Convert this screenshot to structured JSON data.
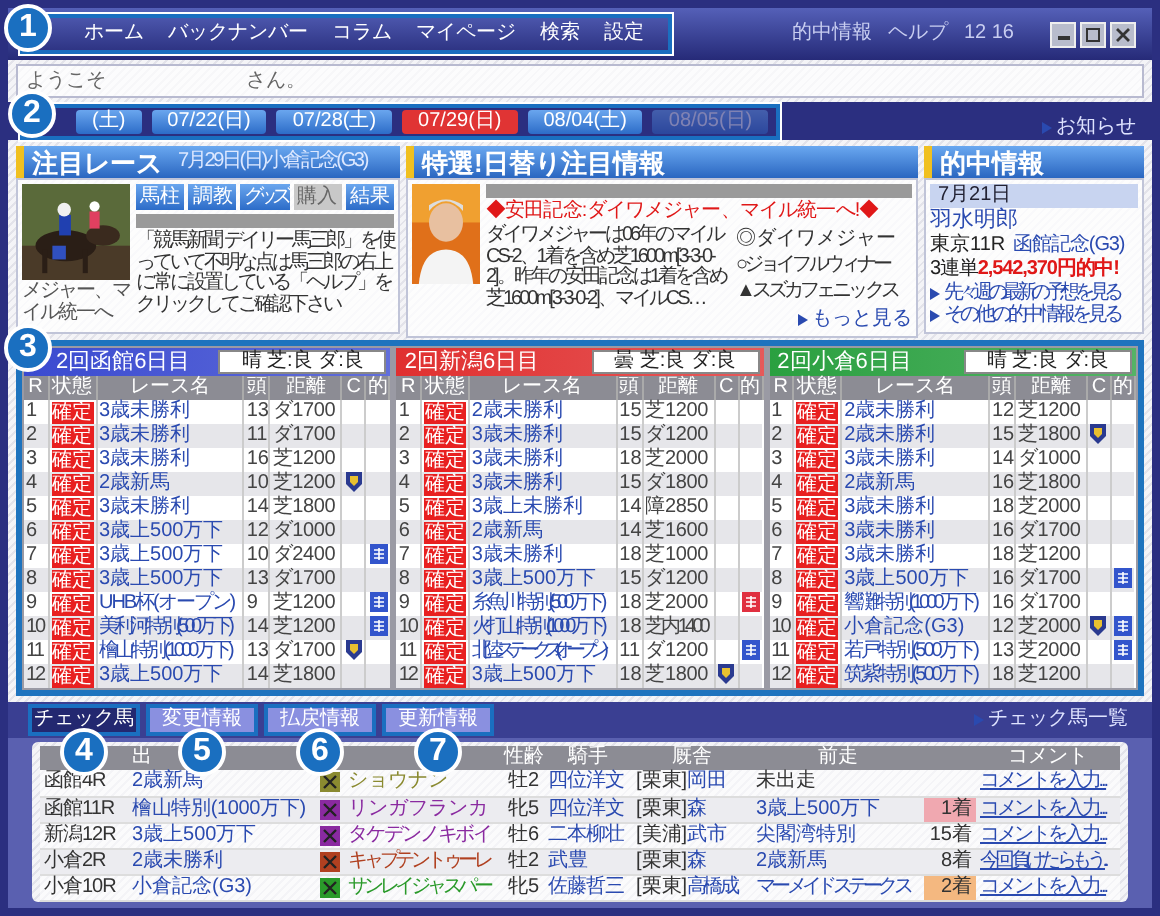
{
  "nav": {
    "items": [
      "ホーム",
      "バックナンバー",
      "コラム",
      "マイページ",
      "検索",
      "設定"
    ],
    "right_links": [
      "的中情報",
      "ヘルプ"
    ],
    "clock": "12 16"
  },
  "welcome": {
    "prefix": "ようこそ",
    "suffix": "さん。"
  },
  "date_tabs": [
    {
      "label": "(土)",
      "selected": false,
      "disabled": false
    },
    {
      "label": "07/22(日)",
      "selected": false,
      "disabled": false
    },
    {
      "label": "07/28(土)",
      "selected": false,
      "disabled": false
    },
    {
      "label": "07/29(日)",
      "selected": true,
      "disabled": false
    },
    {
      "label": "08/04(土)",
      "selected": false,
      "disabled": false
    },
    {
      "label": "08/05(日)",
      "selected": false,
      "disabled": true
    }
  ],
  "notice_link": "お知らせ",
  "featured_race": {
    "title": "注目レース",
    "subtitle": "7月29日(日)小倉記念(G3)",
    "photo_caption": "メジャー、マイル統一へ",
    "buttons": [
      {
        "label": "馬柱",
        "disabled": false
      },
      {
        "label": "調教",
        "disabled": false
      },
      {
        "label": "グッズ",
        "disabled": false
      },
      {
        "label": "購入",
        "disabled": true
      },
      {
        "label": "結果",
        "disabled": false
      }
    ],
    "notice": "「競馬新聞 デイリー馬三郎」を使っていて不明な点は馬三郎の右上に常に設置している「ヘルプ」をクリックしてご確認下さい"
  },
  "daily_pick": {
    "title": "特選!日替り注目情報",
    "headline": "◆安田記念:ダイワメジャー、マイル統一へ!◆",
    "body": "ダイワメジャーは06年のマイルCS-2、1着を含め芝1600m[3-3-0-2]。昨年の安田記念は1着を含め芝1600m[3-3-0-2]、マイルCS…",
    "picks": [
      "◎ダイワメジャー",
      "○ジョイフルウィナー",
      "▲スズカフェニックス"
    ],
    "more_link": "もっと見る"
  },
  "hit_info": {
    "title": "的中情報",
    "date": "7月21日",
    "name": "羽水明郎",
    "race_prefix": "東京11R",
    "race_link": "函館記念(G3)",
    "payout": "3連単**2,542,370円的中!**",
    "links": [
      "先々週の最新の予想を見る",
      "その他の的中情報を見る"
    ]
  },
  "venues": [
    {
      "title": "2回函館6日目",
      "weather": "晴 芝:良 ダ:良",
      "color": "#3a4ad0",
      "columns": [
        "R",
        "状態",
        "レース名",
        "頭",
        "距離",
        "C",
        "的"
      ],
      "rows": [
        {
          "r": "1",
          "status": "確定",
          "name": "3歳未勝利",
          "runners": "13",
          "distance": "ダ1700",
          "checked": false
        },
        {
          "r": "2",
          "status": "確定",
          "name": "3歳未勝利",
          "runners": "11",
          "distance": "ダ1700",
          "checked": false
        },
        {
          "r": "3",
          "status": "確定",
          "name": "3歳未勝利",
          "runners": "16",
          "distance": "芝1200",
          "checked": false
        },
        {
          "r": "4",
          "status": "確定",
          "name": "2歳新馬",
          "runners": "10",
          "distance": "芝1200",
          "checked": true
        },
        {
          "r": "5",
          "status": "確定",
          "name": "3歳未勝利",
          "runners": "14",
          "distance": "芝1800",
          "checked": false
        },
        {
          "r": "6",
          "status": "確定",
          "name": "3歳上500万下",
          "runners": "12",
          "distance": "ダ1000",
          "checked": false
        },
        {
          "r": "7",
          "status": "確定",
          "name": "3歳上500万下",
          "runners": "10",
          "distance": "ダ2400",
          "checked": false,
          "bet": {
            "color": "#3355cc"
          }
        },
        {
          "r": "8",
          "status": "確定",
          "name": "3歳上500万下",
          "runners": "13",
          "distance": "ダ1700",
          "checked": false
        },
        {
          "r": "9",
          "status": "確定",
          "name": "UHB杯(オープン)",
          "runners": "9",
          "distance": "芝1200",
          "checked": false,
          "bet": {
            "color": "#3355cc"
          }
        },
        {
          "r": "10",
          "status": "確定",
          "name": "美利河特別(500万下)",
          "runners": "14",
          "distance": "芝1200",
          "checked": false,
          "bet": {
            "color": "#3355cc"
          }
        },
        {
          "r": "11",
          "status": "確定",
          "name": "檜山特別(1000万下)",
          "runners": "13",
          "distance": "ダ1700",
          "checked": true
        },
        {
          "r": "12",
          "status": "確定",
          "name": "3歳上500万下",
          "runners": "14",
          "distance": "芝1800",
          "checked": false
        }
      ]
    },
    {
      "title": "2回新潟6日目",
      "weather": "曇 芝:良 ダ:良",
      "color": "#e03030",
      "columns": [
        "R",
        "状態",
        "レース名",
        "頭",
        "距離",
        "C",
        "的"
      ],
      "rows": [
        {
          "r": "1",
          "status": "確定",
          "name": "2歳未勝利",
          "runners": "15",
          "distance": "芝1200",
          "checked": false
        },
        {
          "r": "2",
          "status": "確定",
          "name": "3歳未勝利",
          "runners": "15",
          "distance": "ダ1200",
          "checked": false
        },
        {
          "r": "3",
          "status": "確定",
          "name": "3歳未勝利",
          "runners": "18",
          "distance": "芝2000",
          "checked": false
        },
        {
          "r": "4",
          "status": "確定",
          "name": "3歳未勝利",
          "runners": "15",
          "distance": "ダ1800",
          "checked": false
        },
        {
          "r": "5",
          "status": "確定",
          "name": "3歳上未勝利",
          "runners": "14",
          "distance": "障2850",
          "checked": false
        },
        {
          "r": "6",
          "status": "確定",
          "name": "2歳新馬",
          "runners": "14",
          "distance": "芝1600",
          "checked": false
        },
        {
          "r": "7",
          "status": "確定",
          "name": "3歳未勝利",
          "runners": "18",
          "distance": "芝1000",
          "checked": false
        },
        {
          "r": "8",
          "status": "確定",
          "name": "3歳上500万下",
          "runners": "15",
          "distance": "ダ1200",
          "checked": false
        },
        {
          "r": "9",
          "status": "確定",
          "name": "糸魚川特別(500万下)",
          "runners": "18",
          "distance": "芝2000",
          "checked": false,
          "bet": {
            "color": "#e03040"
          }
        },
        {
          "r": "10",
          "status": "確定",
          "name": "火打山特別(1000万下)",
          "runners": "18",
          "distance": "芝内1400",
          "checked": false
        },
        {
          "r": "11",
          "status": "確定",
          "name": "北陸ステークス(オープン)",
          "runners": "11",
          "distance": "ダ1200",
          "checked": false,
          "bet": {
            "color": "#3355cc"
          }
        },
        {
          "r": "12",
          "status": "確定",
          "name": "3歳上500万下",
          "runners": "18",
          "distance": "芝1800",
          "checked": true
        }
      ]
    },
    {
      "title": "2回小倉6日目",
      "weather": "晴 芝:良 ダ:良",
      "color": "#2aa040",
      "columns": [
        "R",
        "状態",
        "レース名",
        "頭",
        "距離",
        "C",
        "的"
      ],
      "rows": [
        {
          "r": "1",
          "status": "確定",
          "name": "2歳未勝利",
          "runners": "12",
          "distance": "芝1200",
          "checked": false
        },
        {
          "r": "2",
          "status": "確定",
          "name": "2歳未勝利",
          "runners": "15",
          "distance": "芝1800",
          "checked": true
        },
        {
          "r": "3",
          "status": "確定",
          "name": "3歳未勝利",
          "runners": "14",
          "distance": "ダ1000",
          "checked": false
        },
        {
          "r": "4",
          "status": "確定",
          "name": "2歳新馬",
          "runners": "16",
          "distance": "芝1800",
          "checked": false
        },
        {
          "r": "5",
          "status": "確定",
          "name": "3歳未勝利",
          "runners": "18",
          "distance": "芝2000",
          "checked": false
        },
        {
          "r": "6",
          "status": "確定",
          "name": "3歳未勝利",
          "runners": "16",
          "distance": "ダ1700",
          "checked": false
        },
        {
          "r": "7",
          "status": "確定",
          "name": "3歳未勝利",
          "runners": "18",
          "distance": "芝1200",
          "checked": false
        },
        {
          "r": "8",
          "status": "確定",
          "name": "3歳上500万下",
          "runners": "16",
          "distance": "ダ1700",
          "checked": false,
          "bet": {
            "color": "#3355cc"
          }
        },
        {
          "r": "9",
          "status": "確定",
          "name": "響灘特別(1000万下)",
          "runners": "16",
          "distance": "ダ1700",
          "checked": false
        },
        {
          "r": "10",
          "status": "確定",
          "name": "小倉記念(G3)",
          "runners": "12",
          "distance": "芝2000",
          "checked": true,
          "bet": {
            "color": "#3355cc"
          }
        },
        {
          "r": "11",
          "status": "確定",
          "name": "若戸特別(500万下)",
          "runners": "13",
          "distance": "芝2000",
          "checked": false,
          "bet": {
            "color": "#3355cc"
          }
        },
        {
          "r": "12",
          "status": "確定",
          "name": "筑紫特別(500万下)",
          "runners": "18",
          "distance": "芝1200",
          "checked": false
        }
      ]
    }
  ],
  "bottom": {
    "tabs": [
      {
        "label": "チェック馬",
        "selected": true
      },
      {
        "label": "変更情報",
        "selected": false
      },
      {
        "label": "払戻情報",
        "selected": false
      },
      {
        "label": "更新情報",
        "selected": false
      }
    ],
    "list_link": "チェック馬一覧",
    "header": {
      "entry": "出",
      "sex_age": "性齢",
      "jockey": "騎手",
      "stable": "厩舎",
      "last_race": "前走",
      "comment": "コメント"
    },
    "rows": [
      {
        "race": "函館4R",
        "entry": "2歳新馬",
        "color": "#8a8a30",
        "horse": "ショウナン",
        "sex_age": "牡2",
        "jockey": "四位洋文",
        "region": "[栗東]",
        "trainer": "岡田",
        "last_race": "未出走",
        "last_race_link": false,
        "comment": "コメントを入力..."
      },
      {
        "race": "函館11R",
        "entry": "檜山特別(1000万下)",
        "color": "#8a2aa0",
        "horse": "リンガフランカ",
        "sex_age": "牝5",
        "jockey": "四位洋文",
        "region": "[栗東]",
        "trainer": "森",
        "last_race": "3歳上500万下",
        "last_race_link": true,
        "finish": {
          "label": "1着",
          "color": "#f0a8b0"
        },
        "comment": "コメントを入力..."
      },
      {
        "race": "新潟12R",
        "entry": "3歳上500万下",
        "color": "#8a2aa0",
        "horse": "タケデンノキボイ",
        "sex_age": "牡6",
        "jockey": "二本柳壮",
        "region": "[美浦]",
        "trainer": "武市",
        "last_race": "尖閣湾特別",
        "last_race_link": true,
        "finish": {
          "label": "15着"
        },
        "comment": "コメントを入力..."
      },
      {
        "race": "小倉2R",
        "entry": "2歳未勝利",
        "color": "#b04020",
        "horse": "キャプテントゥーレ",
        "sex_age": "牡2",
        "jockey": "武豊",
        "region": "[栗東]",
        "trainer": "森",
        "last_race": "2歳新馬",
        "last_race_link": true,
        "finish": {
          "label": "8着"
        },
        "comment": "今回負けたらもう..."
      },
      {
        "race": "小倉10R",
        "entry": "小倉記念(G3)",
        "color": "#2a9a2a",
        "horse": "サンレイジャスパー",
        "sex_age": "牝5",
        "jockey": "佐藤哲三",
        "region": "[栗東]",
        "trainer": "高橋成",
        "last_race": "マーメイドステークス",
        "last_race_link": true,
        "finish": {
          "label": "2着",
          "color": "#f4b880"
        },
        "comment": "コメントを入力..."
      }
    ]
  },
  "callouts": [
    "1",
    "2",
    "3",
    "4",
    "5",
    "6",
    "7"
  ]
}
